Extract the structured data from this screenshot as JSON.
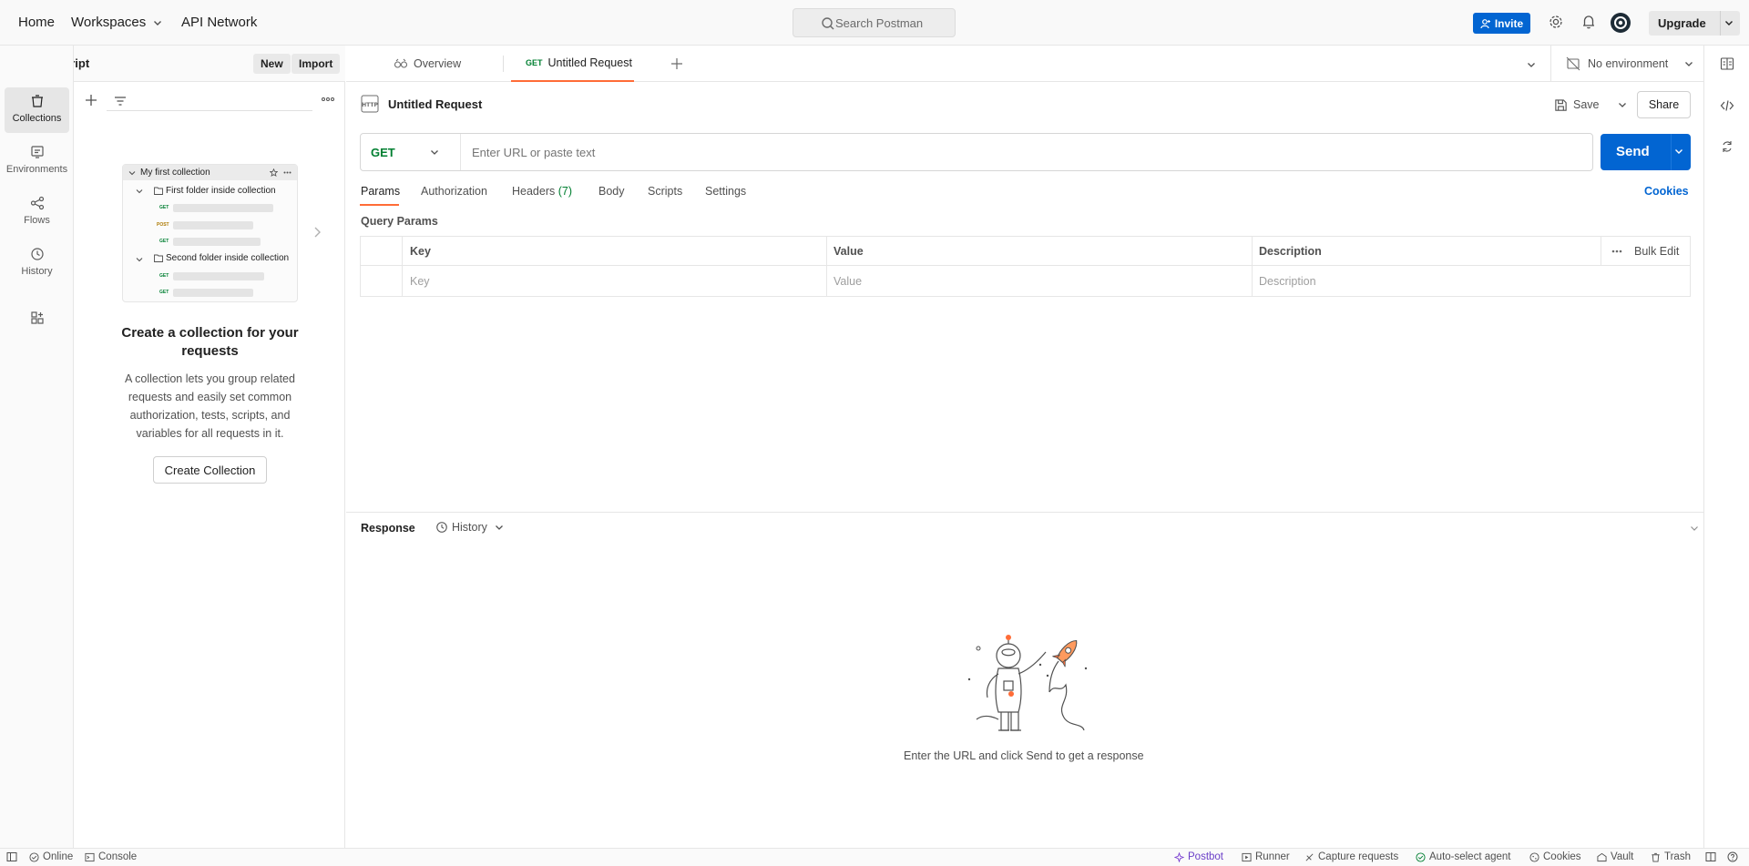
{
  "topbar": {
    "home": "Home",
    "workspaces": "Workspaces",
    "api_network": "API Network",
    "search_placeholder": "Search Postman",
    "invite": "Invite",
    "upgrade": "Upgrade"
  },
  "workspace": {
    "name": "javaScript",
    "new_btn": "New",
    "import_btn": "Import"
  },
  "rail": {
    "collections": "Collections",
    "environments": "Environments",
    "flows": "Flows",
    "history": "History"
  },
  "sidebar": {
    "illustration": {
      "collection": "My first collection",
      "folder1": "First folder inside collection",
      "folder2": "Second folder inside collection",
      "m_get": "GET",
      "m_post": "POST"
    },
    "empty_title": "Create a collection for your requests",
    "empty_desc": "A collection lets you group related requests and easily set common authorization, tests, scripts, and variables for all requests in it.",
    "create_btn": "Create Collection"
  },
  "tabs": {
    "overview": "Overview",
    "untitled_method": "GET",
    "untitled_label": "Untitled Request"
  },
  "environment": "No environment",
  "request": {
    "title": "Untitled Request",
    "save": "Save",
    "share": "Share",
    "method": "GET",
    "url_placeholder": "Enter URL or paste text",
    "send": "Send",
    "tabs": {
      "params": "Params",
      "authorization": "Authorization",
      "headers": "Headers",
      "headers_count": "(7)",
      "body": "Body",
      "scripts": "Scripts",
      "settings": "Settings"
    },
    "cookies": "Cookies",
    "query_params": "Query Params",
    "table": {
      "key": "Key",
      "value": "Value",
      "description": "Description",
      "bulk_edit": "Bulk Edit",
      "key_ph": "Key",
      "value_ph": "Value",
      "description_ph": "Description"
    }
  },
  "response": {
    "title": "Response",
    "history": "History",
    "empty": "Enter the URL and click Send to get a response"
  },
  "statusbar": {
    "online": "Online",
    "console": "Console",
    "postbot": "Postbot",
    "runner": "Runner",
    "capture": "Capture requests",
    "agent": "Auto-select agent",
    "cookies": "Cookies",
    "vault": "Vault",
    "trash": "Trash"
  },
  "colors": {
    "accent_orange": "#ff6c37",
    "primary_blue": "#0265d2",
    "get_green": "#007f31",
    "post_orange": "#ad7a03"
  }
}
